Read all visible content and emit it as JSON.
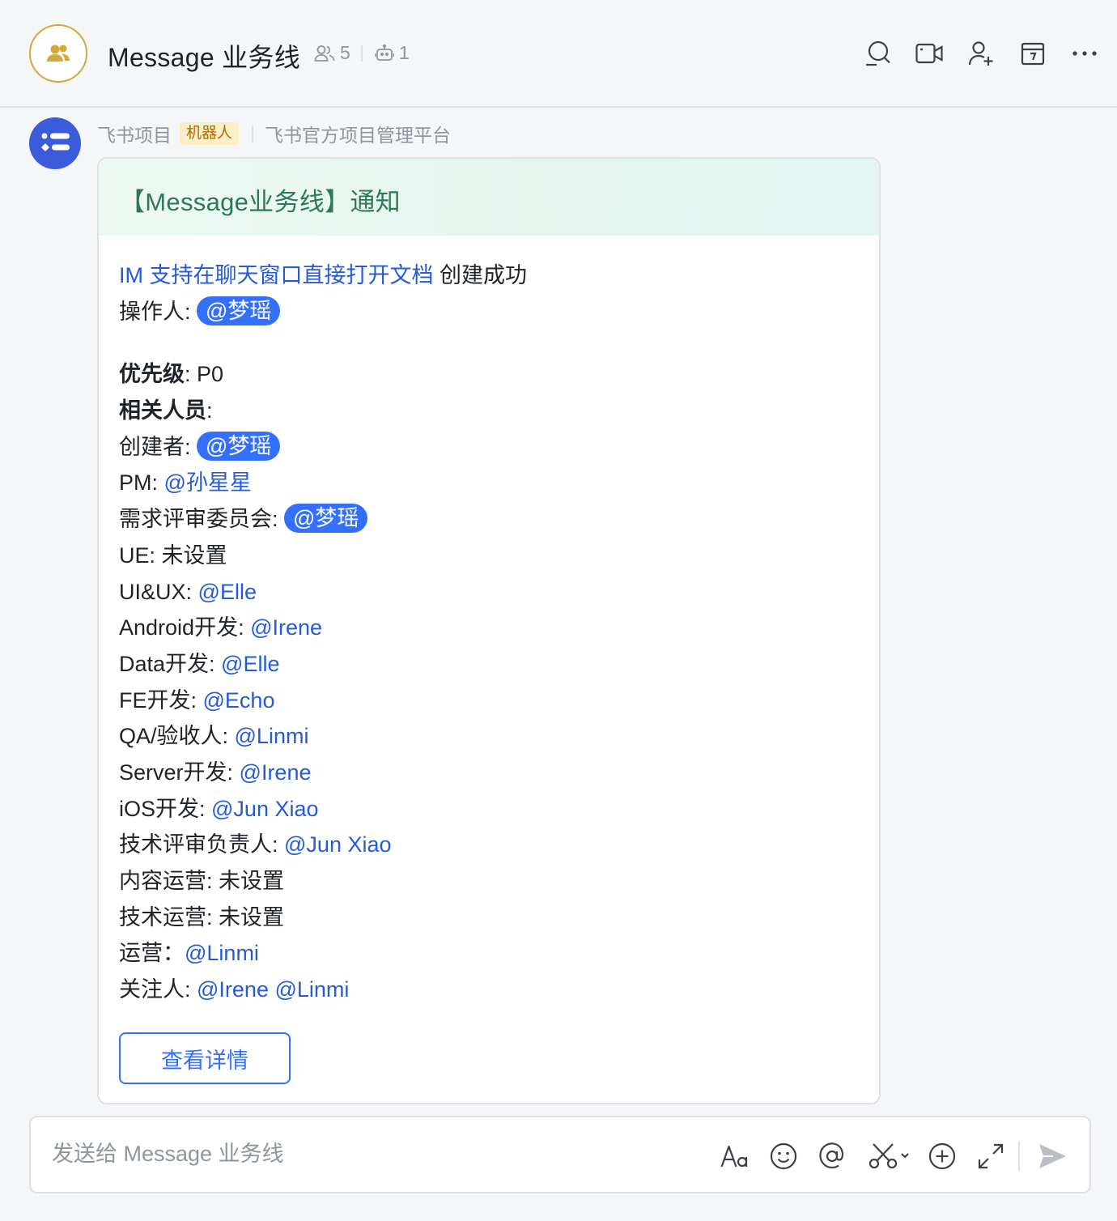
{
  "header": {
    "title": "Message 业务线",
    "member_count": "5",
    "bot_count": "1",
    "avatar_color": "#d4a93a"
  },
  "message": {
    "sender_name": "飞书项目",
    "bot_badge": "机器人",
    "sender_desc": "飞书官方项目管理平台",
    "card": {
      "title": "【Message业务线】通知",
      "doc_link": "IM 支持在聊天窗口直接打开文档",
      "created_text": " 创建成功",
      "operator_label": "操作人: ",
      "operator": "@梦瑶",
      "priority_label": "优先级",
      "priority_value": ": P0",
      "people_label": "相关人员",
      "people_colon": ":",
      "roles": [
        {
          "label": "创建者: ",
          "value": "@梦瑶"
        },
        {
          "label": "PM: ",
          "value": "@孙星星"
        },
        {
          "label": "需求评审委员会: ",
          "value": "@梦瑶"
        },
        {
          "label": "UE: 未设置",
          "value": ""
        },
        {
          "label": "UI&UX: ",
          "value": "@Elle"
        },
        {
          "label": "Android开发: ",
          "value": "@Irene"
        },
        {
          "label": "Data开发: ",
          "value": "@Elle"
        },
        {
          "label": "FE开发: ",
          "value": "@Echo"
        },
        {
          "label": "QA/验收人: ",
          "value": "@Linmi"
        },
        {
          "label": "Server开发: ",
          "value": "@Irene"
        },
        {
          "label": "iOS开发: ",
          "value": "@Jun Xiao"
        },
        {
          "label": "技术评审负责人: ",
          "value": "@Jun Xiao"
        },
        {
          "label": "内容运营: 未设置",
          "value": ""
        },
        {
          "label": "技术运营: 未设置",
          "value": ""
        },
        {
          "label": "运营：",
          "value": "@Linmi"
        },
        {
          "label": "关注人: ",
          "value": "@Irene @Linmi"
        }
      ],
      "button_label": "查看详情"
    }
  },
  "composer": {
    "placeholder": "发送给 Message 业务线"
  },
  "colors": {
    "link": "#245bdb",
    "mention_pill": "#3370ff",
    "card_title": "#2b7a55",
    "bot_avatar": "#3b5bdb"
  }
}
